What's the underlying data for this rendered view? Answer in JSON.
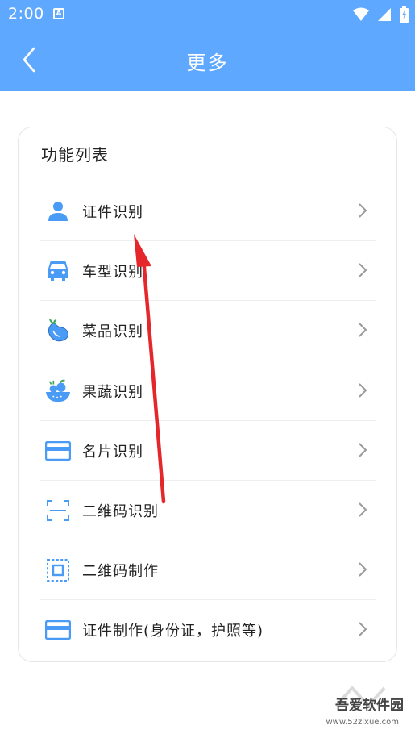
{
  "status_bar": {
    "time": "2:00",
    "notification_letter": "A"
  },
  "app_bar": {
    "title": "更多"
  },
  "card": {
    "title": "功能列表"
  },
  "items": [
    {
      "label": "证件识别",
      "icon": "person-icon"
    },
    {
      "label": "车型识别",
      "icon": "car-icon"
    },
    {
      "label": "菜品识别",
      "icon": "eggplant-icon"
    },
    {
      "label": "果蔬识别",
      "icon": "fruit-bowl-icon"
    },
    {
      "label": "名片识别",
      "icon": "card-icon"
    },
    {
      "label": "二维码识别",
      "icon": "qr-scan-icon"
    },
    {
      "label": "二维码制作",
      "icon": "qr-make-icon"
    },
    {
      "label": "证件制作(身份证，护照等)",
      "icon": "id-card-icon"
    }
  ],
  "watermark": {
    "text": "吾爱软件园",
    "url": "www.52zixue.com"
  },
  "colors": {
    "primary": "#5EA9FF",
    "icon": "#4A9BF5",
    "annotation_arrow": "#E5262B"
  }
}
